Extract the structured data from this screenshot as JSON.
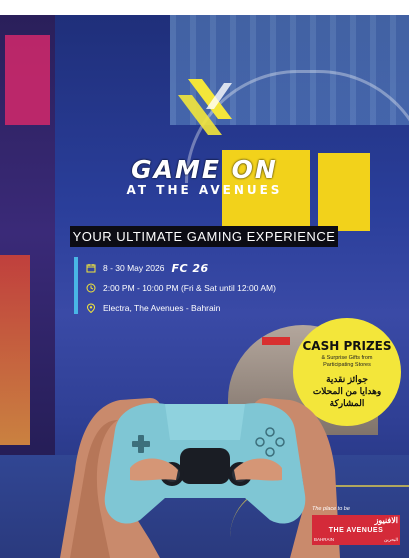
{
  "event": {
    "title": "GAME ON",
    "subtitle": "AT THE AVENUES",
    "tagline": "YOUR ULTIMATE GAMING EXPERIENCE",
    "date": "8 - 30 May 2026",
    "partner_badge": "FC 26",
    "time": "2:00 PM - 10:00 PM (Fri & Sat until 12:00 AM)",
    "location": "Electra, The Avenues - Bahrain"
  },
  "prizes": {
    "title": "CASH PRIZES",
    "subtitle": "& Surprise Gifts from Participating Stores",
    "arabic_line1": "جوائز نقدية",
    "arabic_line2": "وهدايا من المحلات",
    "arabic_line3": "المشاركة"
  },
  "footer": {
    "tagline": "The place to be",
    "brand_arabic": "الافنيوز",
    "brand": "THE AVENUES",
    "location_en": "BAHRAIN",
    "location_ar": "البحرين"
  },
  "colors": {
    "accent_yellow": "#f3e63a",
    "info_bar": "#49b6e6",
    "brand_red": "#d42a39"
  },
  "icons": {
    "date": "calendar-icon",
    "time": "clock-icon",
    "location": "location-pin-icon",
    "logo": "game-on-logo-icon"
  }
}
